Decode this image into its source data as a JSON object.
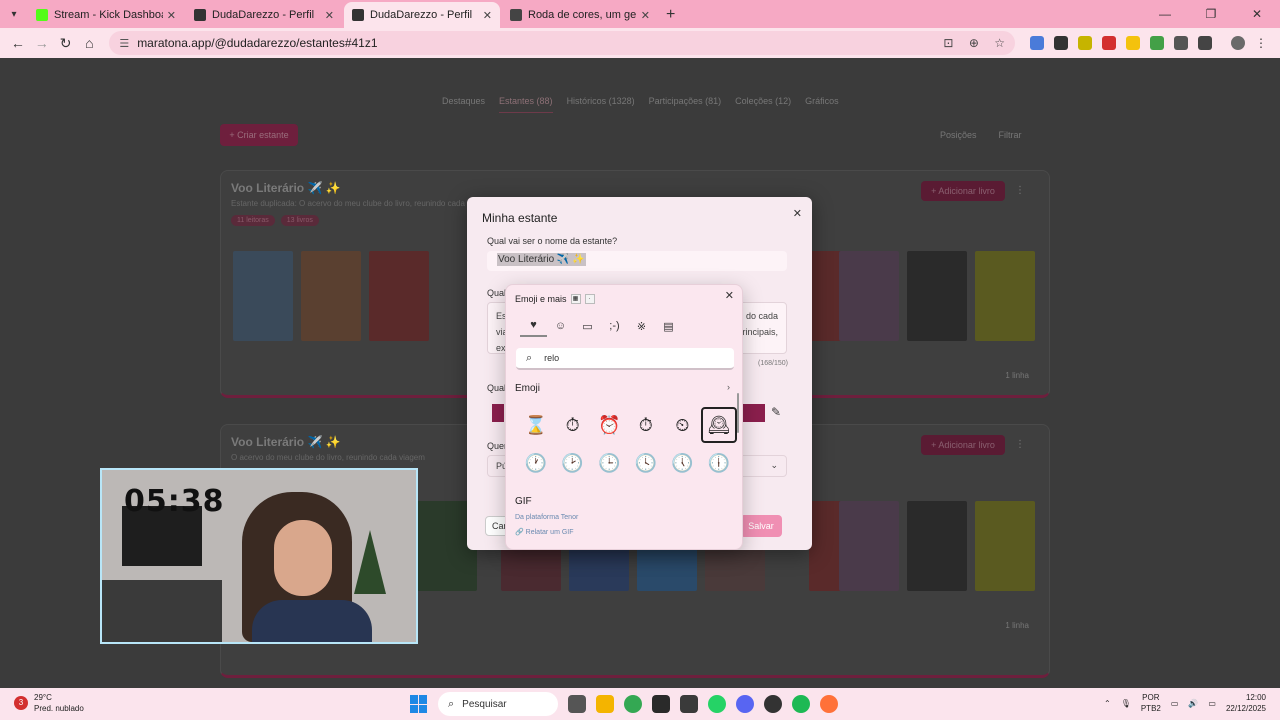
{
  "browser": {
    "tabs": [
      {
        "title": "Stream - Kick Dashboard",
        "favicon_color": "#53fc18",
        "active": false
      },
      {
        "title": "DudaDarezzo - Perfil",
        "favicon_color": "#333333",
        "active": false
      },
      {
        "title": "DudaDarezzo - Perfil",
        "favicon_color": "#333333",
        "active": true
      },
      {
        "title": "Roda de cores, um gerador de p",
        "favicon_color": "#444444",
        "active": false
      }
    ],
    "url": "maratona.app/@dudadarezzo/estantes#41z1"
  },
  "page": {
    "nav_tabs": [
      "Destaques",
      "Estantes (88)",
      "Históricos (1328)",
      "Participações (81)",
      "Coleções (12)",
      "Gráficos"
    ],
    "create_button": "+ Criar estante",
    "positions_label": "Posições",
    "filter_label": "Filtrar",
    "shelves": [
      {
        "title": "Voo Literário ✈️ ✨",
        "description": "Estante duplicada: O acervo do meu clube do livro, reunindo cada viagem literária...",
        "badges": [
          "11 leitoras",
          "13 livros"
        ],
        "add_label": "+ Adicionar livro",
        "footer": "1 linha"
      },
      {
        "title": "Voo Literário ✈️ ✨",
        "description": "O acervo do meu clube do livro, reunindo cada viagem",
        "add_label": "+ Adicionar livro",
        "footer": "1 linha"
      }
    ]
  },
  "modal": {
    "title": "Minha estante",
    "name_label": "Qual vai ser o nome da estante?",
    "name_value": "Voo Literário ✈️ ✨",
    "desc_label": "Qual",
    "desc_text_left": "Es",
    "desc_text_left2": "via",
    "desc_text_left3": "ex",
    "desc_text_right": "do cada",
    "desc_text_right2": "rincipais,",
    "counter": "(168/150)",
    "color_label": "Qual",
    "visibility_label": "Quem",
    "visibility_value": "Pú",
    "cancel_label": "Cancelar",
    "save_label": "Salvar"
  },
  "emoji_panel": {
    "title": "Emoji e mais",
    "categories": [
      "heart-note",
      "smiley",
      "keyboard",
      "kaomoji",
      "symbols",
      "clipboard"
    ],
    "search_value": "relo",
    "section_emoji": "Emoji",
    "emojis": [
      "⌛",
      "⏱",
      "⏰",
      "⏱",
      "⏲",
      "🕰",
      "🕐",
      "🕑",
      "🕒",
      "🕓",
      "🕔",
      "🕕"
    ],
    "section_gif": "GIF",
    "tenor_text": "Da plataforma Tenor",
    "report_text": "Relatar um GIF"
  },
  "webcam": {
    "timer": "05:38"
  },
  "taskbar": {
    "weather_temp": "29°C",
    "weather_desc": "Pred. nublado",
    "weather_badge": "3",
    "search_label": "Pesquisar",
    "lang_1": "POR",
    "lang_2": "PTB2",
    "time": "12:00",
    "date": "22/12/2025"
  }
}
